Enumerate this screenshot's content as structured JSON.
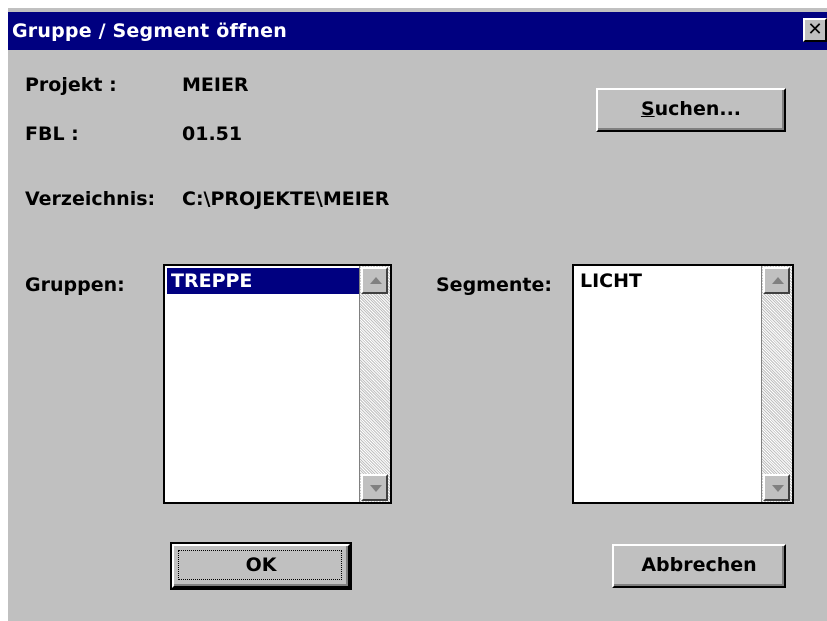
{
  "dialog": {
    "title": "Gruppe / Segment öffnen",
    "close_glyph": "✕"
  },
  "info": {
    "projekt_label": "Projekt :",
    "projekt_value": "MEIER",
    "fbl_label": "FBL :",
    "fbl_value": "01.51",
    "verzeichnis_label": "Verzeichnis:",
    "verzeichnis_value": "C:\\PROJEKTE\\MEIER"
  },
  "buttons": {
    "suchen_first": "S",
    "suchen_rest": "uchen...",
    "ok": "OK",
    "abbrechen": "Abbrechen"
  },
  "gruppen": {
    "label": "Gruppen:",
    "items": [
      "TREPPE"
    ],
    "selected": "TREPPE"
  },
  "segmente": {
    "label": "Segmente:",
    "items": [
      "LICHT"
    ]
  },
  "colors": {
    "titlebar": "#000080",
    "dialog_bg": "#c0c0c0",
    "selection": "#000080"
  }
}
